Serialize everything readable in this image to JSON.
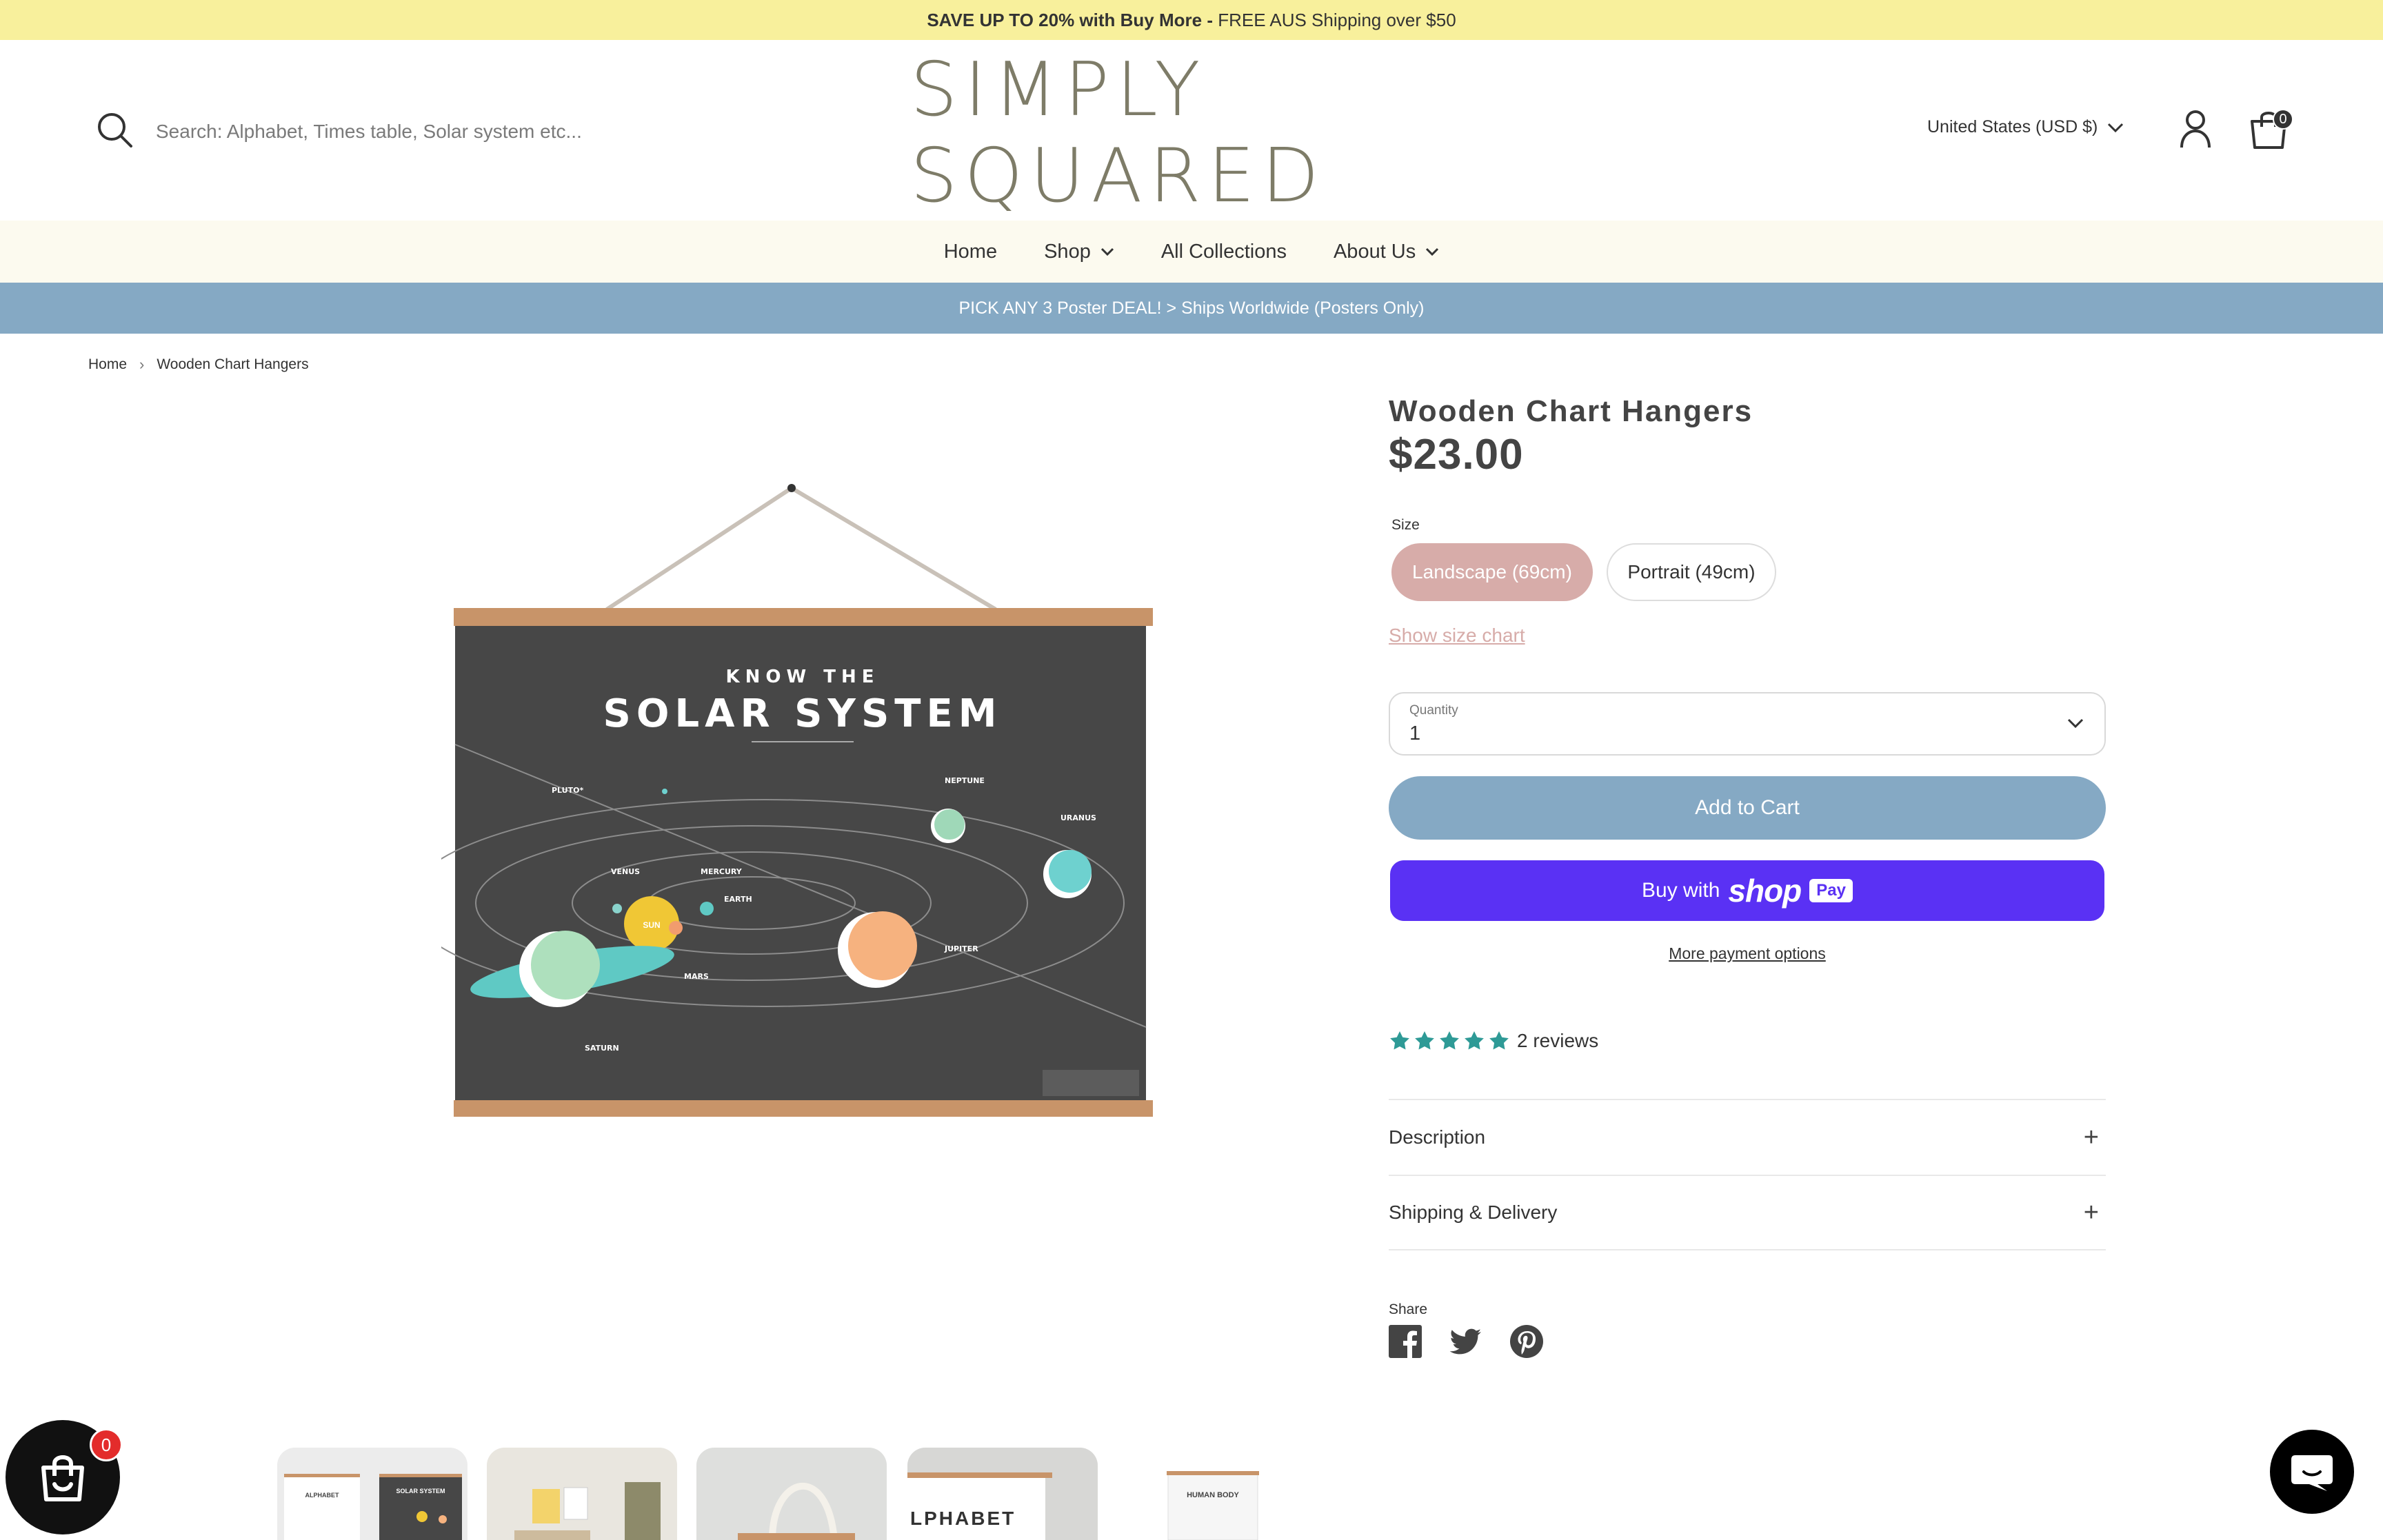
{
  "announcement": {
    "bold": "SAVE UP TO 20% with Buy More - ",
    "rest": "FREE AUS Shipping over $50"
  },
  "header": {
    "search_placeholder": "Search: Alphabet, Times table, Solar system etc...",
    "logo_text": "SIMPLY SQUARED",
    "currency": "United States (USD $)",
    "cart_count": "0"
  },
  "nav": {
    "items": [
      {
        "label": "Home"
      },
      {
        "label": "Shop"
      },
      {
        "label": "All Collections"
      },
      {
        "label": "About Us"
      }
    ]
  },
  "promo": "PICK ANY 3 Poster DEAL! > Ships Worldwide (Posters Only)",
  "breadcrumb": {
    "home": "Home",
    "current": "Wooden Chart Hangers"
  },
  "poster": {
    "pre_title": "KNOW THE",
    "title": "SOLAR SYSTEM",
    "planets": {
      "pluto": "PLUTO*",
      "neptune": "NEPTUNE",
      "uranus": "URANUS",
      "venus": "VENUS",
      "mercury": "MERCURY",
      "earth": "EARTH",
      "sun": "SUN",
      "mars": "MARS",
      "jupiter": "JUPITER",
      "saturn": "SATURN"
    }
  },
  "product": {
    "title": "Wooden Chart Hangers",
    "price": "$23.00",
    "size_label": "Size",
    "sizes": [
      {
        "label": "Landscape (69cm)",
        "selected": true
      },
      {
        "label": "Portrait (49cm)",
        "selected": false
      }
    ],
    "size_chart_link": "Show size chart",
    "quantity_label": "Quantity",
    "quantity_value": "1",
    "add_to_cart": "Add to Cart",
    "shop_pay": {
      "prefix": "Buy with",
      "brand": "shop",
      "badge": "Pay"
    },
    "more_payment": "More payment options",
    "rating": 5,
    "reviews": "2 reviews",
    "accordion": {
      "description": "Description",
      "shipping": "Shipping & Delivery"
    },
    "share_label": "Share"
  },
  "thumbnails": [
    {
      "caption_a": "ALPHABET",
      "caption_b": "SOLAR SYSTEM"
    },
    {
      "caption": ""
    },
    {
      "caption": ""
    },
    {
      "caption": "LPHABET"
    },
    {
      "caption": "HUMAN BODY"
    }
  ],
  "float_cart_count": "0",
  "colors": {
    "announcement_bg": "#f8f09c",
    "promo_bg": "#85a9c4",
    "accent_pink": "#d7aca9",
    "shop_pay": "#5a31f4",
    "star": "#2e9a96"
  }
}
